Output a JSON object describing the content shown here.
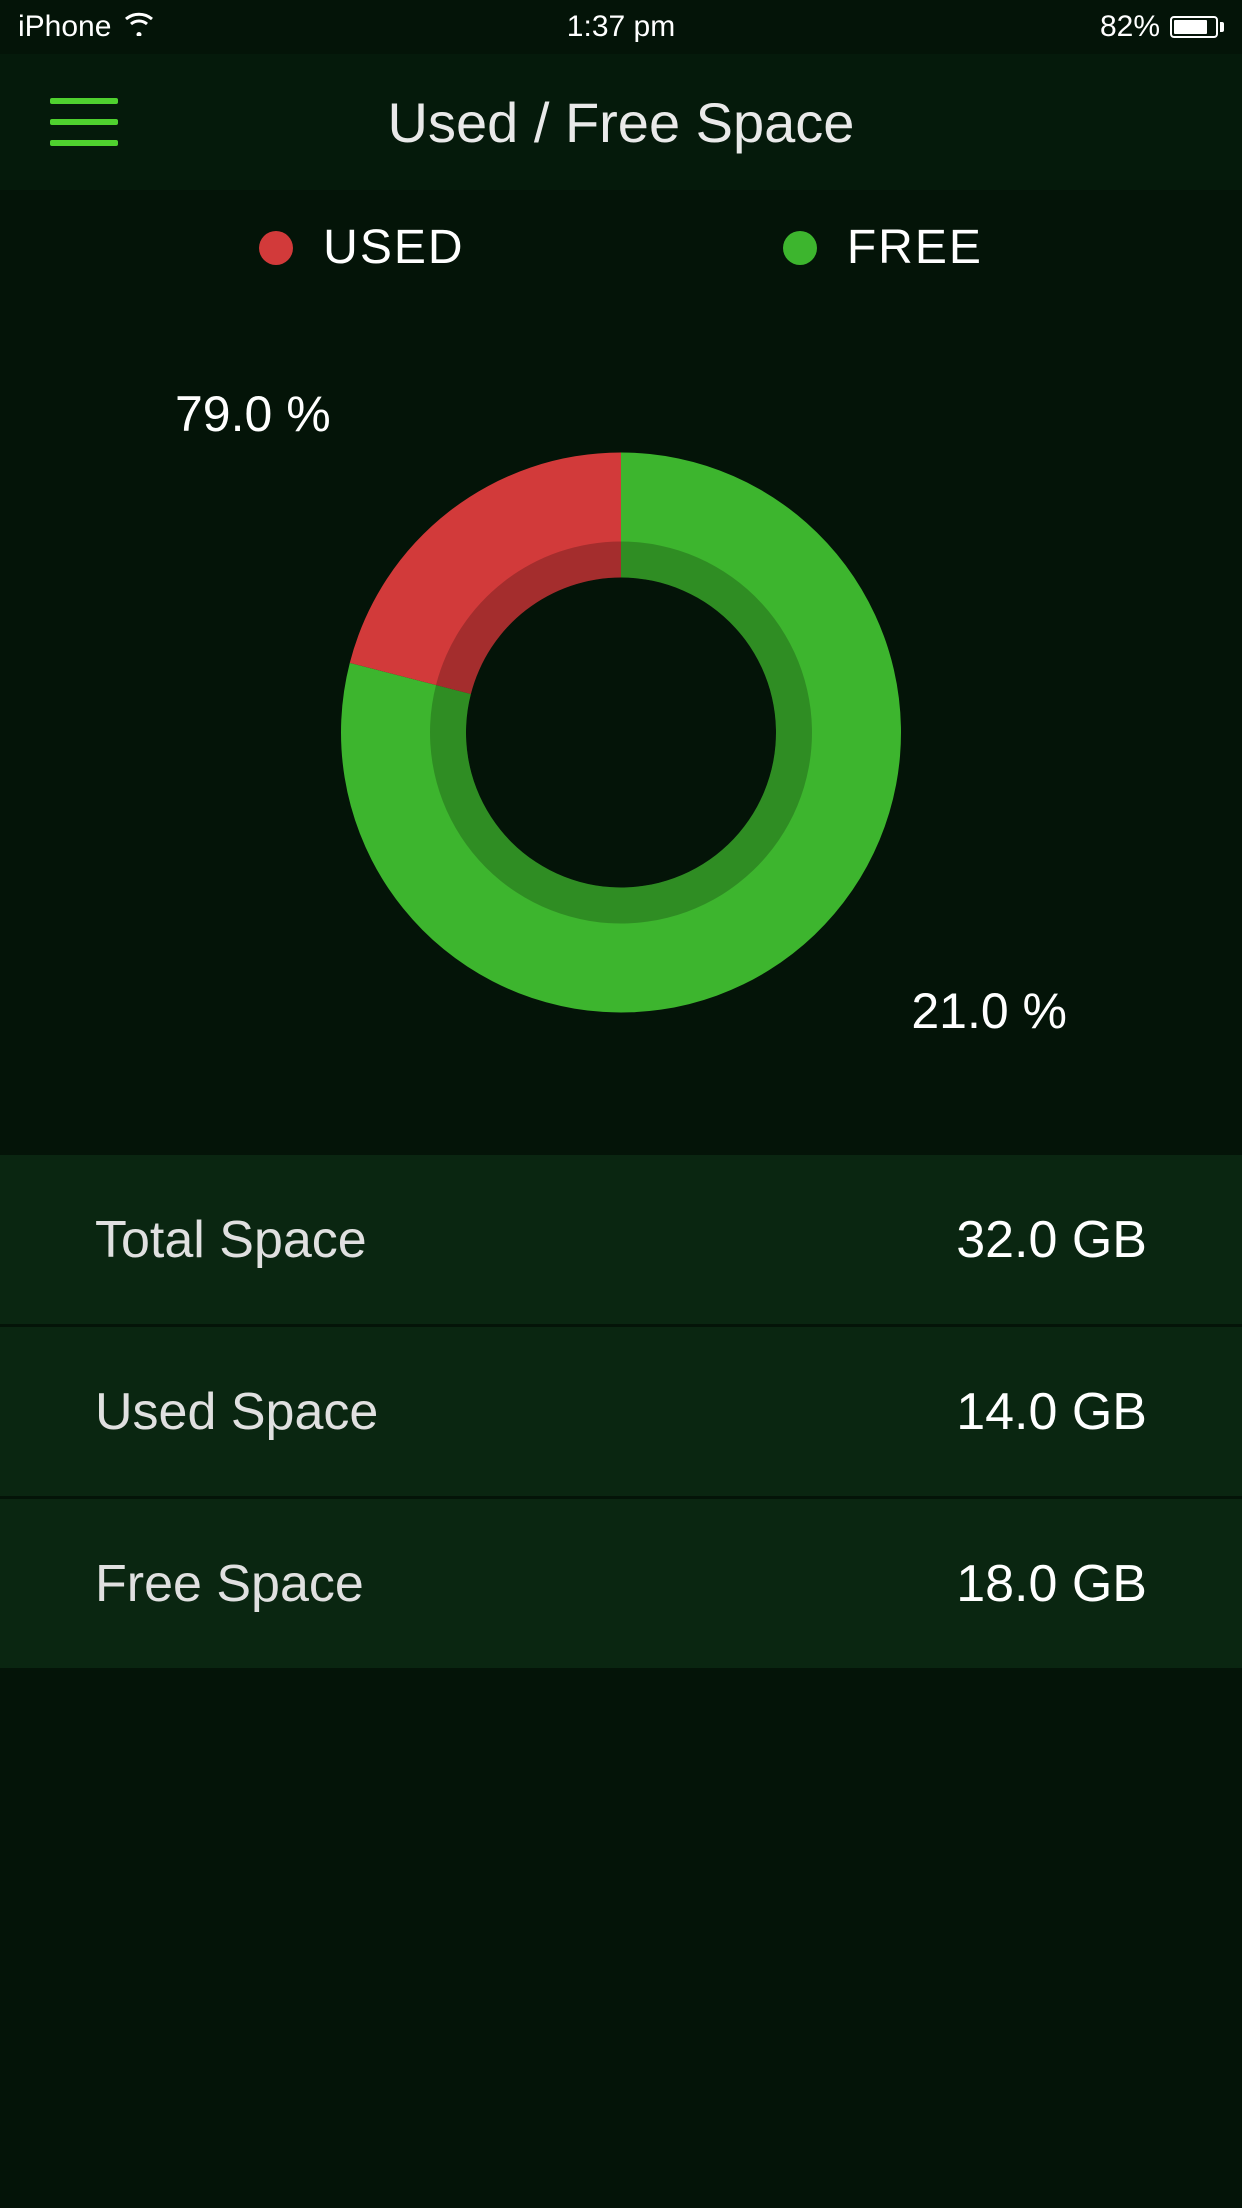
{
  "status": {
    "carrier": "iPhone",
    "time": "1:37 pm",
    "battery_pct": "82%",
    "battery_level": 82
  },
  "header": {
    "title": "Used / Free Space"
  },
  "legend": {
    "used": {
      "label": "USED",
      "color": "#d23a3a"
    },
    "free": {
      "label": "FREE",
      "color": "#3db52e"
    }
  },
  "labels": {
    "free_pct": "79.0 %",
    "used_pct": "21.0 %"
  },
  "stats": [
    {
      "label": "Total Space",
      "value": "32.0 GB"
    },
    {
      "label": "Used Space",
      "value": "14.0 GB"
    },
    {
      "label": "Free Space",
      "value": "18.0 GB"
    }
  ],
  "chart_data": {
    "type": "pie",
    "title": "Used / Free Space",
    "colors": {
      "used": "#d23a3a",
      "free": "#3db52e"
    },
    "series": [
      {
        "name": "FREE",
        "value": 79.0
      },
      {
        "name": "USED",
        "value": 21.0
      }
    ]
  }
}
